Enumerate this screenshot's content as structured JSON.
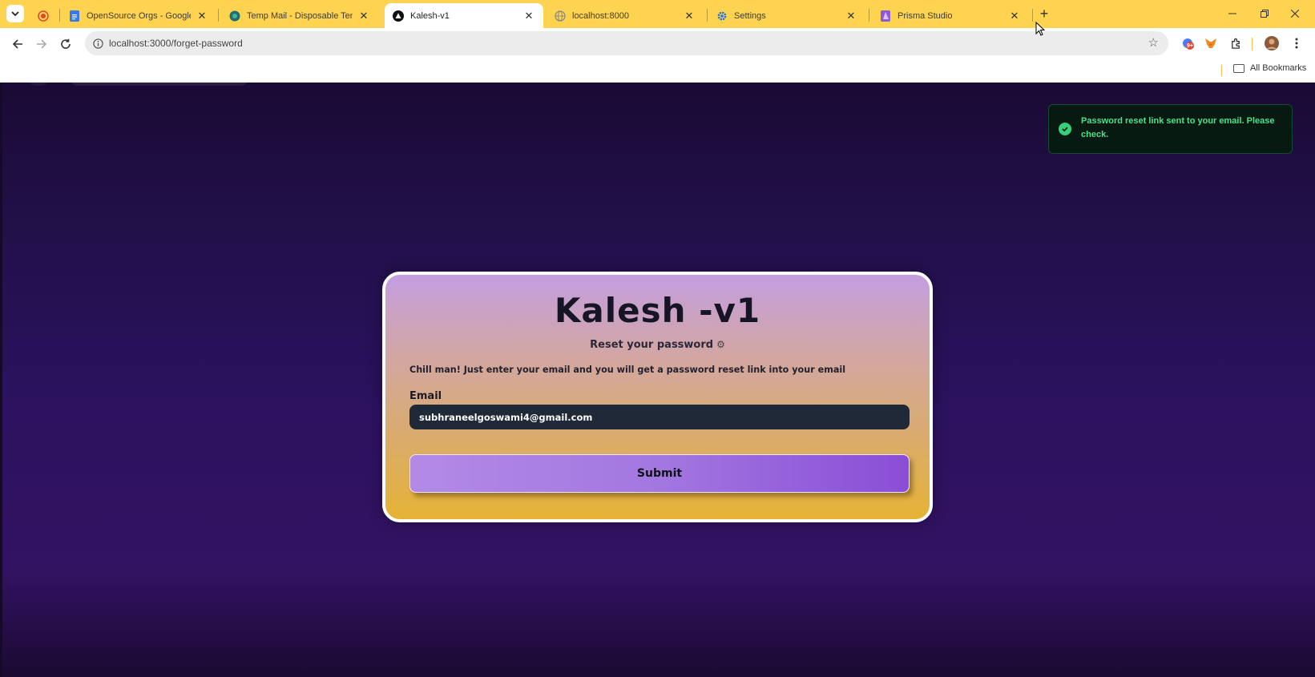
{
  "browser": {
    "tabs": [
      {
        "title": "",
        "icon": "recording-icon",
        "active": false
      },
      {
        "title": "OpenSource Orgs - Google Doc",
        "icon": "google-docs-icon",
        "active": false
      },
      {
        "title": "Temp Mail - Disposable Tempor",
        "icon": "temp-mail-icon",
        "active": false
      },
      {
        "title": "Kalesh-v1",
        "icon": "vercel-triangle-icon",
        "active": true
      },
      {
        "title": "localhost:8000",
        "icon": "globe-icon",
        "active": false
      },
      {
        "title": "Settings",
        "icon": "settings-gear-icon",
        "active": false
      },
      {
        "title": "Prisma Studio",
        "icon": "prisma-icon",
        "active": false
      }
    ],
    "address_bar": {
      "url": "localhost:3000/forget-password"
    },
    "bookmarks": {
      "all_bookmarks_label": "All Bookmarks"
    },
    "extension_badge": "9+"
  },
  "toast": {
    "message": "Password reset link sent to your email. Please check.",
    "status_color": "#34d17a"
  },
  "card": {
    "title": "Kalesh -v1",
    "subtitle": "Reset your password",
    "subtitle_icon": "⚙",
    "description": "Chill man! Just enter your email and you will get a password reset link into your email",
    "email_label": "Email",
    "email_value": "subhraneelgoswami4@gmail.com",
    "submit_label": "Submit"
  },
  "colors": {
    "tabbar": "#fdd34f",
    "page_bg": "#2c1260",
    "toast_text": "#4ee08b",
    "input_bg": "#1f2937",
    "button_accent": "#8a4ed6"
  }
}
